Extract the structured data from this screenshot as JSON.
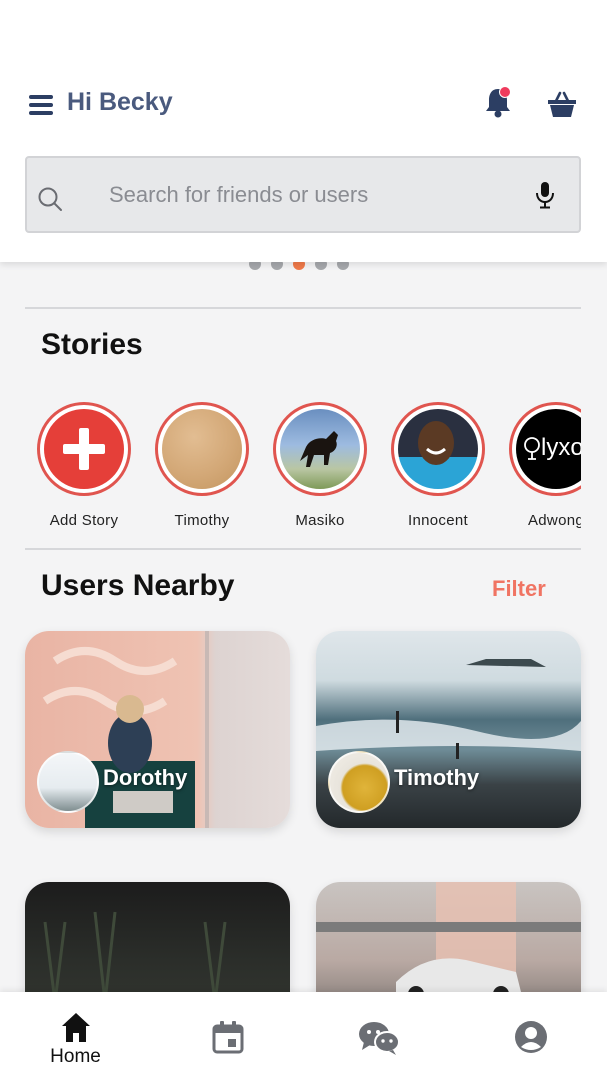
{
  "header": {
    "greeting": "Hi Becky",
    "icons": [
      "menu-icon",
      "bell-icon",
      "basket-icon"
    ]
  },
  "search": {
    "placeholder": "Search for friends or users",
    "icons": [
      "search-icon",
      "microphone-icon"
    ]
  },
  "carousel": {
    "page_count": 5,
    "active_index": 2
  },
  "stories": {
    "title": "Stories",
    "items": [
      {
        "label": "Add Story"
      },
      {
        "label": "Timothy"
      },
      {
        "label": "Masiko"
      },
      {
        "label": "Innocent"
      },
      {
        "label": "Adwong"
      }
    ],
    "lyx_logo_text": "lyxo"
  },
  "nearby": {
    "title": "Users Nearby",
    "filter_label": "Filter",
    "cards": [
      {
        "name": "Dorothy"
      },
      {
        "name": "Timothy"
      },
      {
        "name": ""
      },
      {
        "name": ""
      }
    ]
  },
  "nav": {
    "items": [
      {
        "label": "Home",
        "icon": "home-icon",
        "active": true
      },
      {
        "label": "",
        "icon": "calendar-icon",
        "active": false
      },
      {
        "label": "",
        "icon": "chat-icon",
        "active": false
      },
      {
        "label": "",
        "icon": "profile-icon",
        "active": false
      }
    ]
  },
  "colors": {
    "accent": "#e0554f",
    "filter": "#f07463",
    "dot_active": "#f07a4a",
    "greeting": "#4a5a7e",
    "notification": "#ef3b5d"
  }
}
